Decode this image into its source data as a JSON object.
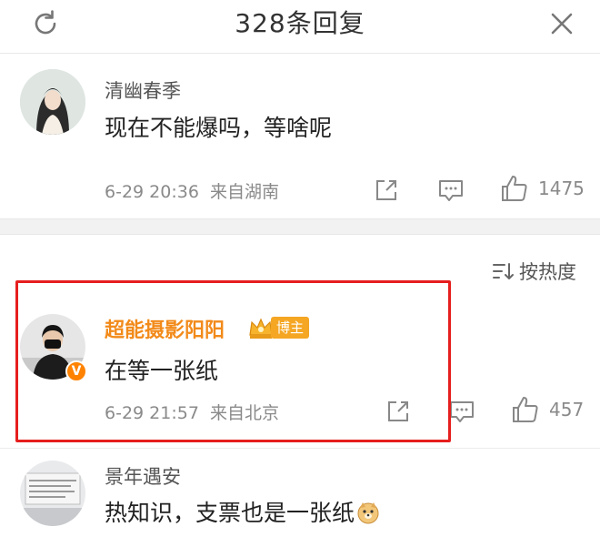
{
  "header": {
    "title": "328条回复",
    "refresh_icon": "refresh-icon",
    "close_icon": "close-icon"
  },
  "comments": [
    {
      "username": "清幽春季",
      "content": "现在不能爆吗，等啥呢",
      "time": "6-29 20:36",
      "location": "来自湖南",
      "likes": "1475"
    }
  ],
  "sort": {
    "label": "按热度",
    "icon": "sort-icon"
  },
  "highlighted_comment": {
    "username": "超能摄影阳阳",
    "badge": "博主",
    "verified_mark": "V",
    "content": "在等一张纸",
    "time": "6-29 21:57",
    "location": "来自北京",
    "likes": "457"
  },
  "third_comment": {
    "username": "景年遇安",
    "content": "热知识，支票也是一张纸"
  },
  "colors": {
    "accent_orange": "#f28a1a",
    "highlight_red": "#e61e1e",
    "meta_gray": "#8a8a8a"
  }
}
